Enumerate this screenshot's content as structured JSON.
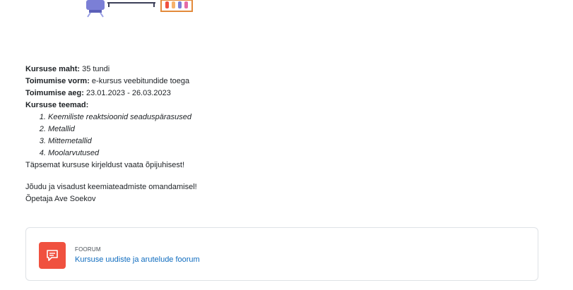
{
  "course": {
    "volume_label": "Kursuse maht:",
    "volume_value": " 35 tundi",
    "form_label": "Toimumise vorm:",
    "form_value": " e-kursus veebitundide toega",
    "time_label": "Toimumise aeg:",
    "time_value": " 23.01.2023 - 26.03.2023",
    "topics_label": "Kursuse teemad:",
    "topics": [
      "Keemiliste reaktsioonid seaduspärasused",
      "Metallid",
      "Mittemetallid",
      "Moolarvutused"
    ],
    "details_note": "Täpsemat kursuse kirjeldust vaata õpijuhisest!",
    "wish": "Jõudu ja visadust keemiateadmiste omandamisel!",
    "teacher": "Õpetaja Ave Soekov"
  },
  "forum": {
    "type_label": "FOORUM",
    "link_text": "Kursuse uudiste ja arutelude foorum",
    "icon": "forum-chat-icon",
    "icon_color": "#f0513f"
  },
  "colors": {
    "link": "#0f6cbf",
    "text": "#1d2125",
    "border": "#dee2e6"
  }
}
